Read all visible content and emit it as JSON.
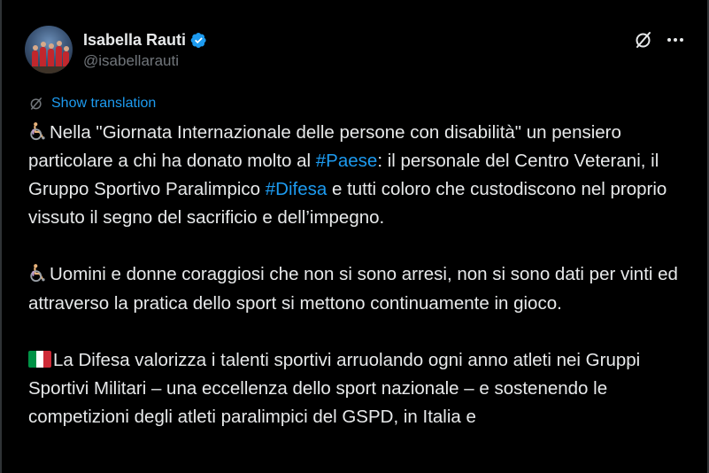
{
  "tweet": {
    "author": {
      "display_name": "Isabella Rauti",
      "handle": "@isabellarauti",
      "verified_icon": "verified-badge-icon",
      "avatar": "profile-photo"
    },
    "actions": {
      "grok_icon": "grok-icon",
      "more_icon": "more-horizontal-icon"
    },
    "translate": {
      "label": "Show translation",
      "icon": "translate-icon"
    },
    "paragraphs": [
      {
        "icon": "manual-wheelchair-icon",
        "segments": [
          {
            "text": "Nella \"Giornata Internazionale delle persone con disabilità\" un pensiero particolare a chi ha donato molto al "
          },
          {
            "text": "#Paese",
            "link": true
          },
          {
            "text": ": il personale del Centro Veterani, il Gruppo Sportivo Paralimpico "
          },
          {
            "text": "#Difesa",
            "link": true
          },
          {
            "text": " e tutti coloro che custodiscono nel proprio vissuto il segno del sacrificio e dell’impegno."
          }
        ]
      },
      {
        "icon": "manual-wheelchair-icon",
        "segments": [
          {
            "text": "Uomini e donne coraggiosi che non si sono arresi, non si sono dati per vinti ed attraverso la pratica dello sport si mettono continuamente in gioco."
          }
        ]
      },
      {
        "icon": "italy-flag-icon",
        "segments": [
          {
            "text": "La Difesa valorizza i talenti sportivi arruolando ogni anno atleti nei Gruppi Sportivi Militari – una eccellenza dello sport nazionale – e sostenendo le competizioni degli atleti paralimpici del GSPD, in Italia e"
          }
        ]
      }
    ]
  },
  "colors": {
    "background": "#000000",
    "text": "#e7e9ea",
    "secondary_text": "#71767b",
    "link": "#1d9bf0",
    "border": "#2f3336"
  }
}
